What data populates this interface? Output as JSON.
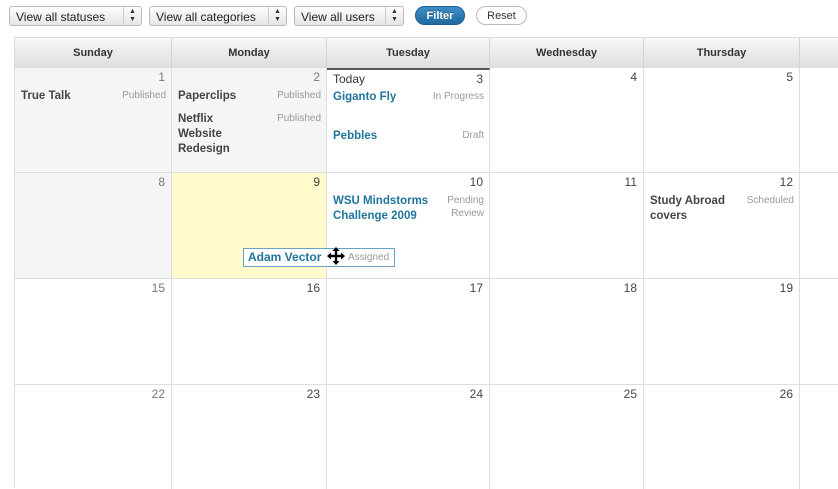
{
  "filters": {
    "statuses": "View all statuses",
    "categories": "View all categories",
    "users": "View all users",
    "filter_button": "Filter",
    "reset_button": "Reset"
  },
  "weekdays": [
    "Sunday",
    "Monday",
    "Tuesday",
    "Wednesday",
    "Thursday"
  ],
  "today_label": "Today",
  "weeks": [
    [
      "1",
      "2",
      "3",
      "4",
      "5"
    ],
    [
      "8",
      "9",
      "10",
      "11",
      "12"
    ],
    [
      "15",
      "16",
      "17",
      "18",
      "19"
    ],
    [
      "22",
      "23",
      "24",
      "25",
      "26"
    ]
  ],
  "posts": {
    "true_talk": {
      "title": "True Talk",
      "status": "Published"
    },
    "paperclips": {
      "title": "Paperclips",
      "status": "Published"
    },
    "netflix": {
      "title": "Netflix Website Redesign",
      "status": "Published"
    },
    "giganto": {
      "title": "Giganto Fly",
      "status": "In Progress"
    },
    "pebbles": {
      "title": "Pebbles",
      "status": "Draft"
    },
    "wsu": {
      "title": "WSU Mindstorms Challenge 2009",
      "status": "Pending Review"
    },
    "study_abroad": {
      "title": "Study Abroad covers",
      "status": "Scheduled"
    },
    "adam_vector": {
      "title": "Adam Vector",
      "status": "Assigned"
    }
  }
}
